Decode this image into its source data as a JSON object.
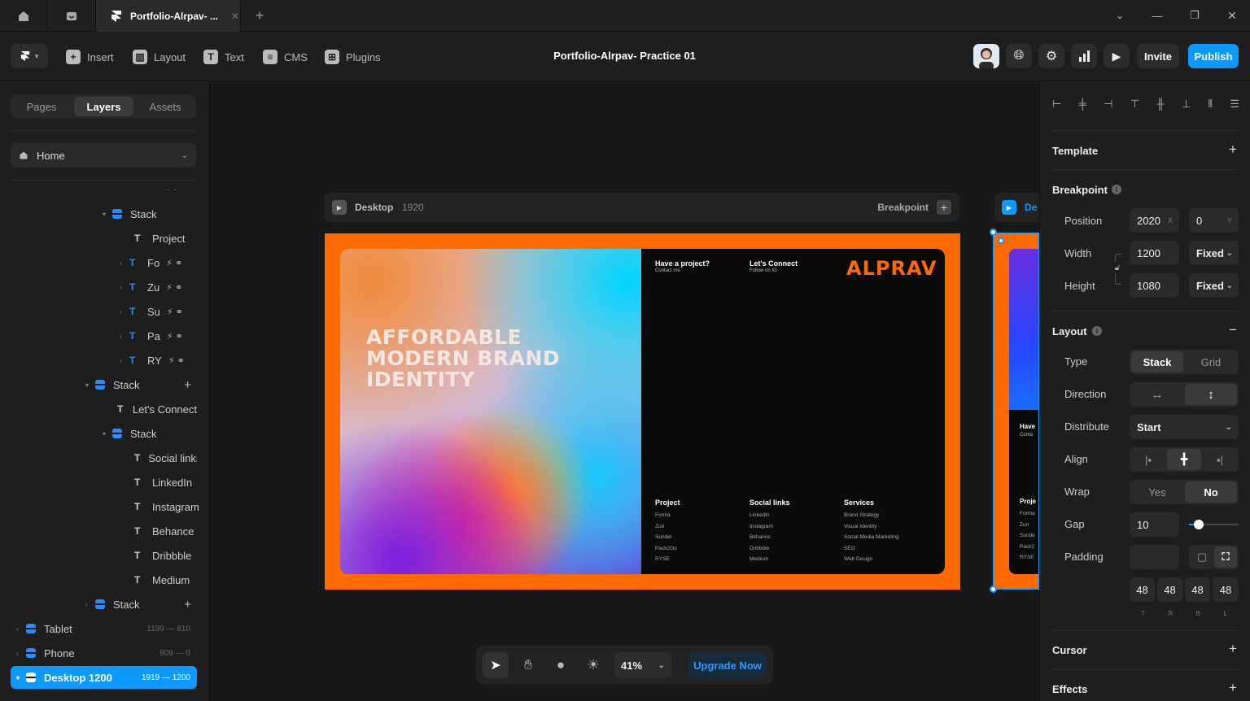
{
  "tabs": {
    "active_title": "Portfolio-Alrpav- ..."
  },
  "toolbar": {
    "insert": "Insert",
    "layout": "Layout",
    "text": "Text",
    "cms": "CMS",
    "plugins": "Plugins",
    "project_title": "Portfolio-Alrpav- Practice 01",
    "invite": "Invite",
    "publish": "Publish"
  },
  "left": {
    "tabs": [
      "Pages",
      "Layers",
      "Assets"
    ],
    "page_select": "Home",
    "layers": [
      {
        "name": "Stack"
      },
      {
        "name": "Project"
      },
      {
        "name": "Fo"
      },
      {
        "name": "Zu"
      },
      {
        "name": "Su"
      },
      {
        "name": "Pa"
      },
      {
        "name": "RY"
      },
      {
        "name": "Stack"
      },
      {
        "name": "Let's Connect"
      },
      {
        "name": "Stack"
      },
      {
        "name": "Social links"
      },
      {
        "name": "LinkedIn"
      },
      {
        "name": "Instagram"
      },
      {
        "name": "Behance"
      },
      {
        "name": "Dribbble"
      },
      {
        "name": "Medium"
      },
      {
        "name": "Stack"
      },
      {
        "name": "Tablet",
        "size": "1199 — 810"
      },
      {
        "name": "Phone",
        "size": "809 — 0"
      },
      {
        "name": "Desktop 1200",
        "size": "1919 — 1200"
      }
    ]
  },
  "canvas": {
    "frame_name": "Desktop",
    "frame_width": "1920",
    "breakpoint": "Breakpoint",
    "second_frame_name": "De",
    "hero": [
      "AFFORDABLE",
      "MODERN BRAND",
      "IDENTITY"
    ],
    "have_project": "Have a project?",
    "contact_me": "Contact me",
    "lets_connect": "Let's Connect",
    "follow_ig": "Follow on IG",
    "logo": "ALPRAV",
    "cols": [
      {
        "title": "Project",
        "items": [
          "Forma",
          "Zuri",
          "Sundel",
          "Pack2Go",
          "RYSE"
        ]
      },
      {
        "title": "Social links",
        "items": [
          "LinkedIn",
          "Instagram",
          "Behance",
          "Dribbble",
          "Medium"
        ]
      },
      {
        "title": "Services",
        "items": [
          "Brand Strategy",
          "Visual Identity",
          "Social Media Marketing",
          "SEO",
          "Web Design"
        ]
      }
    ],
    "peek": {
      "have": "Have",
      "contact": "Conta",
      "proj": "Proje",
      "items": [
        "Forma",
        "Zuri",
        "Sunde",
        "Pack2",
        "RYSE"
      ]
    },
    "zoom": "41%",
    "upgrade": "Upgrade Now"
  },
  "right": {
    "template": "Template",
    "breakpoint": "Breakpoint",
    "position_label": "Position",
    "pos_x": "2020",
    "pos_y": "0",
    "x": "X",
    "y": "Y",
    "width_label": "Width",
    "width": "1200",
    "width_mode": "Fixed",
    "height_label": "Height",
    "height": "1080",
    "height_mode": "Fixed",
    "layout": "Layout",
    "type_label": "Type",
    "type_options": [
      "Stack",
      "Grid"
    ],
    "direction_label": "Direction",
    "distribute_label": "Distribute",
    "distribute": "Start",
    "align_label": "Align",
    "wrap_label": "Wrap",
    "wrap_options": [
      "Yes",
      "No"
    ],
    "gap_label": "Gap",
    "gap": "10",
    "gap_slider": 0.1,
    "padding_label": "Padding",
    "padding": [
      "48",
      "48",
      "48",
      "48"
    ],
    "padding_sides": [
      "T",
      "R",
      "B",
      "L"
    ],
    "cursor": "Cursor",
    "effects": "Effects"
  }
}
